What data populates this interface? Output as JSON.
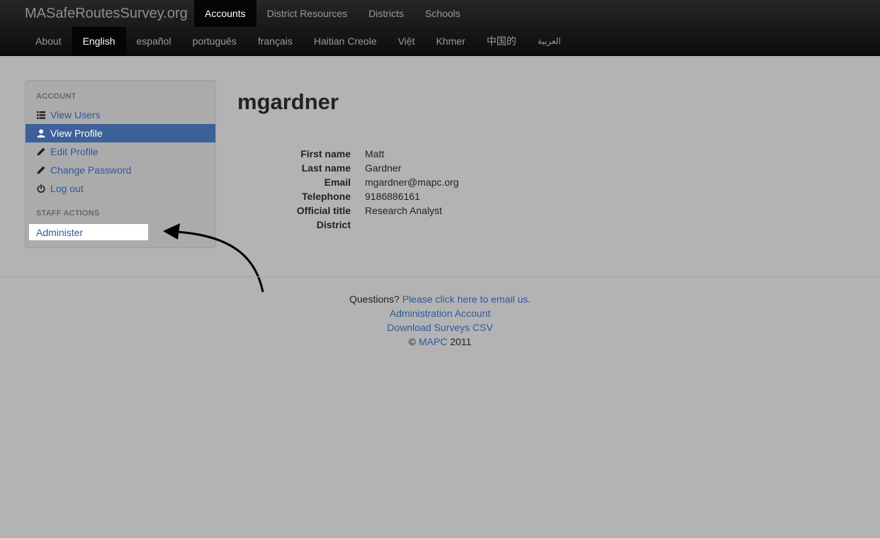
{
  "brand": "MASafeRoutesSurvey.org",
  "nav_main": [
    "Accounts",
    "District Resources",
    "Districts",
    "Schools"
  ],
  "nav_lang": [
    "About",
    "English",
    "español",
    "português",
    "français",
    "Haitian Creole",
    "Việt",
    "Khmer",
    "中国的",
    "العربية"
  ],
  "sidebar": {
    "account_header": "ACCOUNT",
    "items": [
      {
        "label": "View Users",
        "icon": "list-icon"
      },
      {
        "label": "View Profile",
        "icon": "user-icon"
      },
      {
        "label": "Edit Profile",
        "icon": "pencil-icon"
      },
      {
        "label": "Change Password",
        "icon": "pencil-icon"
      },
      {
        "label": "Log out",
        "icon": "power-icon"
      }
    ],
    "staff_header": "STAFF ACTIONS",
    "administer": "Administer"
  },
  "profile": {
    "username": "mgardner",
    "fields": [
      {
        "label": "First name",
        "value": "Matt"
      },
      {
        "label": "Last name",
        "value": "Gardner"
      },
      {
        "label": "Email",
        "value": "mgardner@mapc.org"
      },
      {
        "label": "Telephone",
        "value": "9186886161"
      },
      {
        "label": "Official title",
        "value": "Research Analyst"
      },
      {
        "label": "District",
        "value": ""
      }
    ]
  },
  "footer": {
    "questions": "Questions?",
    "email_link": "Please click here to email us.",
    "admin_link": "Administration Account",
    "csv_link": "Download Surveys CSV",
    "copyright_symbol": "©",
    "mapc_link": "MAPC",
    "year": "2011"
  },
  "colors": {
    "background": "#b3b3b3",
    "navbar": "#1a1a1a",
    "link": "#2d5a9c",
    "active_item": "#3c6198"
  }
}
